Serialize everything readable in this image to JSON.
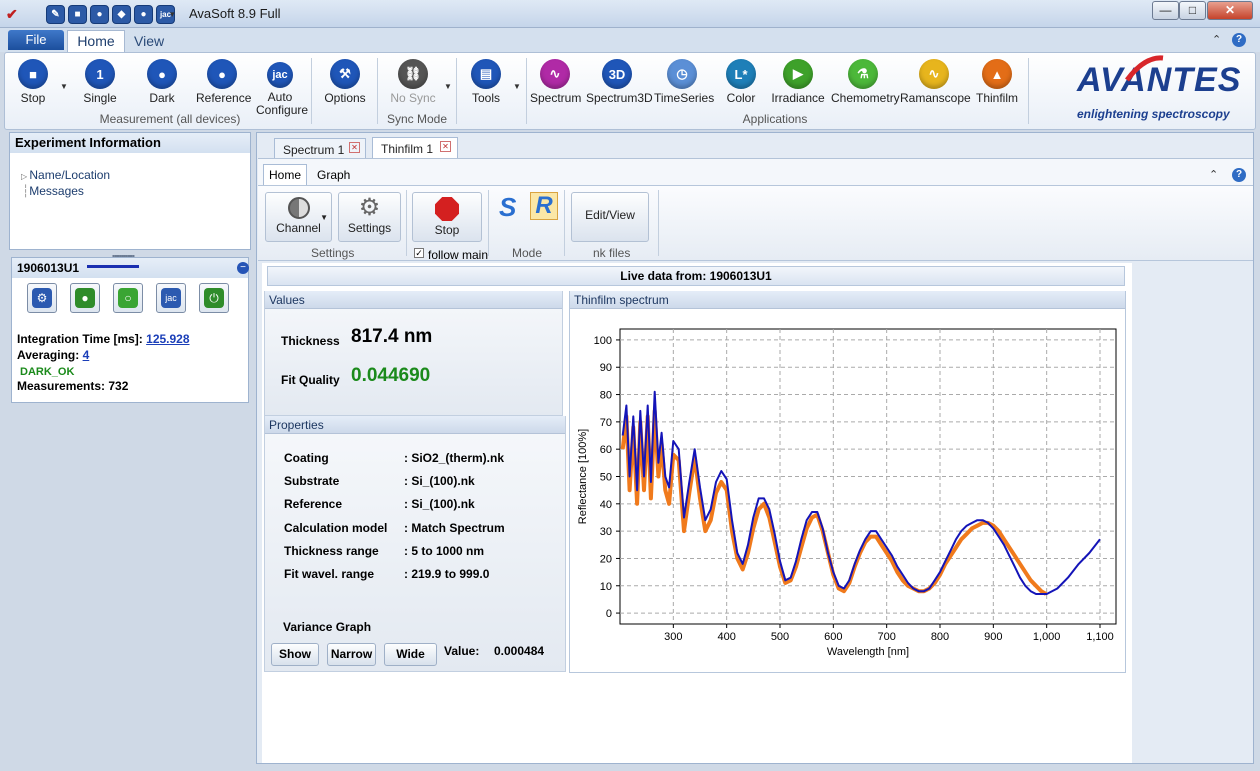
{
  "app": {
    "title": "AvaSoft 8.9 Full",
    "min": "—",
    "max": "□",
    "close": "✕"
  },
  "quick_access": [
    "✎",
    "■",
    "●",
    "◆",
    "●",
    "jac"
  ],
  "menu": {
    "file": "File",
    "home": "Home",
    "view": "View"
  },
  "ribbon": {
    "buttons": [
      {
        "key": "stop",
        "label": "Stop",
        "color": "#1f56b8",
        "glyph": "■"
      },
      {
        "key": "single",
        "label": "Single",
        "color": "#1f56b8",
        "glyph": "1"
      },
      {
        "key": "dark",
        "label": "Dark",
        "color": "#1f56b8",
        "glyph": "●"
      },
      {
        "key": "reference",
        "label": "Reference",
        "color": "#1f56b8",
        "glyph": "●"
      },
      {
        "key": "auto-configure",
        "label": "Auto\nConfigure",
        "color": "#1f56b8",
        "glyph": "jac"
      },
      {
        "key": "options",
        "label": "Options",
        "color": "#1f56b8",
        "glyph": "⚒"
      },
      {
        "key": "no-sync",
        "label": "No Sync",
        "color": "#555",
        "glyph": "⛓"
      },
      {
        "key": "tools",
        "label": "Tools",
        "color": "#1f56b8",
        "glyph": "▤"
      },
      {
        "key": "spectrum",
        "label": "Spectrum",
        "color": "#b02aa6",
        "glyph": "∿"
      },
      {
        "key": "spectrum3d",
        "label": "Spectrum3D",
        "color": "#1f56b8",
        "glyph": "3D"
      },
      {
        "key": "timeseries",
        "label": "TimeSeries",
        "color": "#5b8fd6",
        "glyph": "◷"
      },
      {
        "key": "color",
        "label": "Color",
        "color": "#1e7fb8",
        "glyph": "L*"
      },
      {
        "key": "irradiance",
        "label": "Irradiance",
        "color": "#3ea12a",
        "glyph": "▶"
      },
      {
        "key": "chemometry",
        "label": "Chemometry",
        "color": "#4cb83a",
        "glyph": "⚗"
      },
      {
        "key": "ramanscope",
        "label": "Ramanscope",
        "color": "#e7b51d",
        "glyph": "∿"
      },
      {
        "key": "thinfilm",
        "label": "Thinfilm",
        "color": "#e36d17",
        "glyph": "▲"
      }
    ],
    "groups": {
      "measurement": "Measurement (all devices)",
      "sync": "Sync Mode",
      "applications": "Applications"
    },
    "logo_main": "AVANTES",
    "logo_sub": "enlightening spectroscopy"
  },
  "experiment": {
    "title": "Experiment Information",
    "items": [
      "Name/Location",
      "Messages"
    ]
  },
  "device": {
    "id": "1906013U1",
    "integration_label": "Integration Time  [ms]:",
    "integration_value": "125.928",
    "averaging_label": "Averaging:",
    "averaging_value": "4",
    "dark_status": "DARK_OK",
    "measurements_label": "Measurements:",
    "measurements_value": "732"
  },
  "doc_tabs": [
    "Spectrum 1",
    "Thinfilm 1"
  ],
  "inner": {
    "tabs": [
      "Home",
      "Graph"
    ],
    "channel": "Channel",
    "settings": "Settings",
    "stop": "Stop",
    "follow_main": "follow main",
    "mode_s": "S",
    "mode_r": "R",
    "edit_view": "Edit/View",
    "group_settings": "Settings",
    "group_mode": "Mode",
    "group_nk": "nk files"
  },
  "live": "Live data from: 1906013U1",
  "values": {
    "title": "Values",
    "thickness_label": "Thickness",
    "thickness_value": "817.4 nm",
    "fit_label": "Fit Quality",
    "fit_value": "0.044690"
  },
  "properties": {
    "title": "Properties",
    "rows": [
      {
        "label": "Coating",
        "value": ": SiO2_(therm).nk"
      },
      {
        "label": "Substrate",
        "value": ": Si_(100).nk"
      },
      {
        "label": "Reference",
        "value": ": Si_(100).nk"
      },
      {
        "label": "Calculation model",
        "value": ": Match Spectrum"
      },
      {
        "label": "Thickness range",
        "value": ": 5 to 1000 nm"
      },
      {
        "label": "Fit wavel. range",
        "value": ": 219.9 to 999.0"
      }
    ],
    "variance_title": "Variance Graph",
    "show": "Show",
    "narrow": "Narrow",
    "wide": "Wide",
    "value_label": "Value:",
    "value": "0.000484"
  },
  "chart_panel_title": "Thinfilm spectrum",
  "chart_data": {
    "type": "line",
    "xlabel": "Wavelength [nm]",
    "ylabel": "Reflectance [100%]",
    "xlim": [
      200,
      1130
    ],
    "ylim": [
      -4,
      104
    ],
    "xticks": [
      300,
      400,
      500,
      600,
      700,
      800,
      900,
      1000,
      1100
    ],
    "xtick_labels": [
      "300",
      "400",
      "500",
      "600",
      "700",
      "800",
      "900",
      "1,000",
      "1,100"
    ],
    "yticks": [
      0,
      10,
      20,
      30,
      40,
      50,
      60,
      70,
      80,
      90,
      100
    ],
    "grid": true,
    "series": [
      {
        "color": "#f07a1c",
        "x": [
          205,
          212,
          218,
          225,
          232,
          238,
          245,
          252,
          258,
          265,
          272,
          278,
          285,
          292,
          300,
          310,
          320,
          330,
          340,
          350,
          360,
          370,
          380,
          390,
          400,
          410,
          420,
          430,
          440,
          450,
          460,
          470,
          480,
          490,
          500,
          510,
          520,
          530,
          540,
          550,
          560,
          570,
          580,
          590,
          600,
          610,
          620,
          630,
          640,
          650,
          660,
          670,
          680,
          690,
          700,
          710,
          720,
          730,
          740,
          750,
          760,
          770,
          780,
          790,
          800,
          810,
          820,
          830,
          840,
          850,
          860,
          870,
          880,
          890,
          900,
          910,
          920,
          930,
          940,
          950,
          960,
          970,
          980,
          990,
          999
        ],
        "y": [
          60,
          72,
          45,
          68,
          40,
          70,
          45,
          72,
          42,
          74,
          50,
          62,
          45,
          40,
          58,
          56,
          30,
          44,
          57,
          42,
          30,
          34,
          44,
          48,
          45,
          30,
          20,
          16,
          22,
          31,
          38,
          40,
          35,
          26,
          17,
          11,
          12,
          17,
          24,
          31,
          35,
          36,
          30,
          22,
          14,
          9,
          8,
          11,
          17,
          22,
          26,
          28,
          28,
          25,
          22,
          19,
          15,
          12,
          10,
          9,
          8,
          8,
          9,
          11,
          14,
          18,
          21,
          24,
          27,
          29,
          31,
          32,
          33,
          33,
          32,
          30,
          27,
          24,
          21,
          18,
          15,
          12,
          10,
          8,
          7
        ]
      },
      {
        "color": "#1414b8",
        "x": [
          205,
          212,
          218,
          225,
          232,
          238,
          245,
          252,
          258,
          265,
          272,
          278,
          285,
          292,
          300,
          310,
          320,
          330,
          340,
          350,
          360,
          370,
          380,
          390,
          400,
          410,
          420,
          430,
          440,
          450,
          460,
          470,
          480,
          490,
          500,
          510,
          520,
          530,
          540,
          550,
          560,
          570,
          580,
          590,
          600,
          610,
          620,
          630,
          640,
          650,
          660,
          670,
          680,
          690,
          700,
          710,
          720,
          730,
          740,
          750,
          760,
          770,
          780,
          790,
          800,
          810,
          820,
          830,
          840,
          850,
          860,
          870,
          880,
          890,
          900,
          910,
          920,
          930,
          940,
          950,
          960,
          970,
          980,
          990,
          1000,
          1020,
          1040,
          1060,
          1080,
          1100
        ],
        "y": [
          65,
          76,
          50,
          72,
          45,
          74,
          50,
          76,
          48,
          81,
          55,
          66,
          50,
          46,
          63,
          60,
          35,
          48,
          60,
          46,
          34,
          38,
          48,
          52,
          49,
          34,
          22,
          18,
          25,
          35,
          42,
          42,
          38,
          29,
          19,
          12,
          13,
          19,
          27,
          34,
          37,
          37,
          31,
          22,
          15,
          10,
          9,
          12,
          18,
          23,
          27,
          30,
          30,
          27,
          24,
          21,
          17,
          14,
          11,
          9,
          8,
          8,
          9,
          12,
          15,
          19,
          23,
          27,
          30,
          32,
          33,
          34,
          34,
          33,
          31,
          28,
          25,
          21,
          17,
          13,
          10,
          8,
          7,
          7,
          7,
          9,
          13,
          18,
          22,
          27
        ]
      }
    ]
  }
}
